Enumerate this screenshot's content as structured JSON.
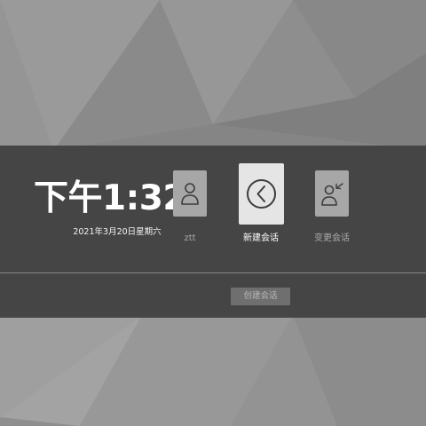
{
  "time": "下午1:32",
  "date": "2021年3月20日星期六",
  "sessions": {
    "user": {
      "label": "ztt",
      "icon": "user-avatar-icon"
    },
    "new_session": {
      "label": "新建会话",
      "icon": "chevron-left-circle-icon"
    },
    "switch_session": {
      "label": "变更会话",
      "icon": "switch-user-icon"
    }
  },
  "create_button": {
    "label": "创建会话"
  },
  "colors": {
    "band": "#404040",
    "tile_inactive": "#a7a7a7",
    "tile_active": "#e5e5e5",
    "icon_stroke": "#3c3c3c",
    "button_bg": "#6f6f6f"
  }
}
